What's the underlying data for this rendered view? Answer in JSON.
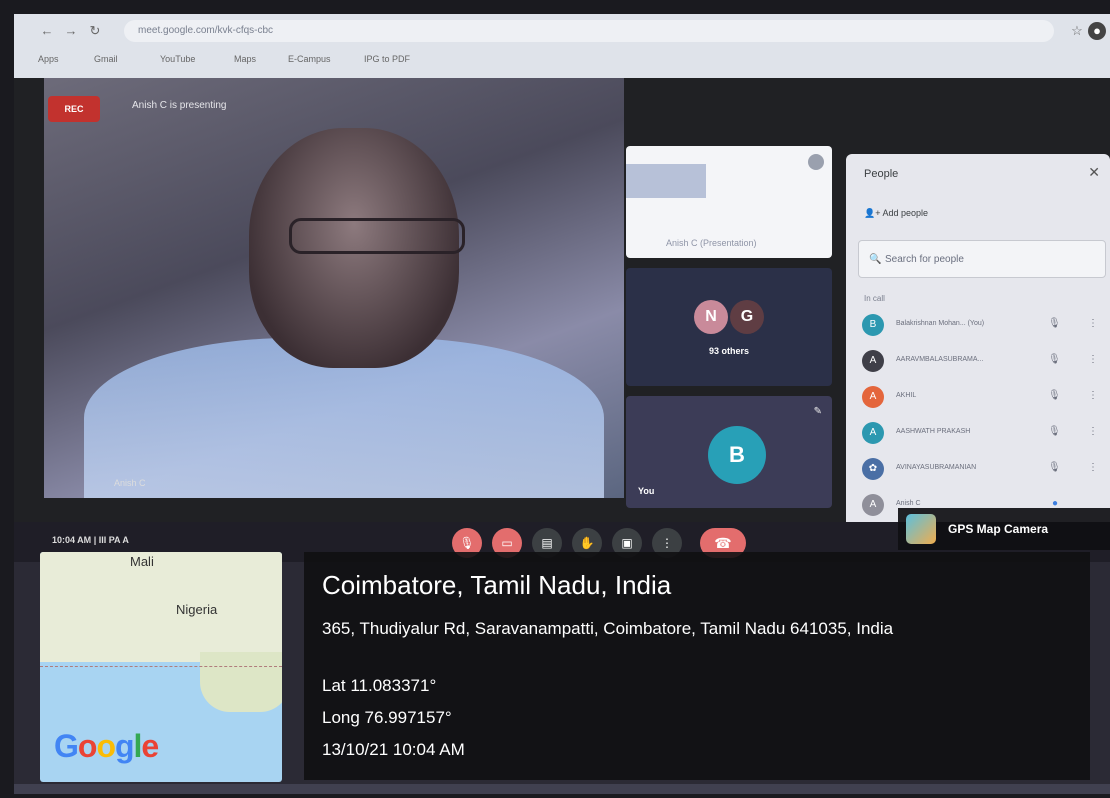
{
  "browser": {
    "url": "meet.google.com/kvk-cfqs-cbc",
    "bookmarks": [
      "Apps",
      "Gmail",
      "YouTube",
      "Maps",
      "E-Campus",
      "IPG to PDF"
    ]
  },
  "meeting": {
    "rec_label": "REC",
    "presenting": "Anish C is presenting",
    "main_name": "Anish C",
    "tile1_caption": "Anish C (Presentation)",
    "tile2_initials": [
      "N",
      "G"
    ],
    "tile2_label": "93 others",
    "tile3_initial": "B",
    "tile3_label": "You",
    "time": "10:04 AM",
    "meeting_code": "III PA A"
  },
  "people": {
    "title": "People",
    "add_people": "Add people",
    "search_placeholder": "Search for people",
    "in_call": "In call",
    "rows": [
      {
        "initial": "B",
        "name": "Balakrishnan Mohan... (You)",
        "color": "#2c98b0"
      },
      {
        "initial": "A",
        "name": "AARAVMBALASUBRAMA...",
        "color": "#3f3f48"
      },
      {
        "initial": "A",
        "name": "AKHIL",
        "color": "#e4663c"
      },
      {
        "initial": "A",
        "name": "AASHWATH PRAKASH",
        "color": "#2c98b0"
      },
      {
        "initial": "✿",
        "name": "AVINAYASUBRAMANIAN",
        "color": "#4a6fa5"
      },
      {
        "initial": "A",
        "name": "Anish C",
        "color": "#8f8f9a"
      }
    ]
  },
  "gps": {
    "badge": "GPS Map Camera",
    "map_labels": {
      "mali": "Mali",
      "nigeria": "Nigeria"
    },
    "google": "Google",
    "place": "Coimbatore, Tamil Nadu, India",
    "address": "365, Thudiyalur Rd, Saravanampatti, Coimbatore, Tamil Nadu 641035, India",
    "lat": "Lat 11.083371°",
    "long": "Long 76.997157°",
    "datetime": "13/10/21 10:04 AM"
  }
}
